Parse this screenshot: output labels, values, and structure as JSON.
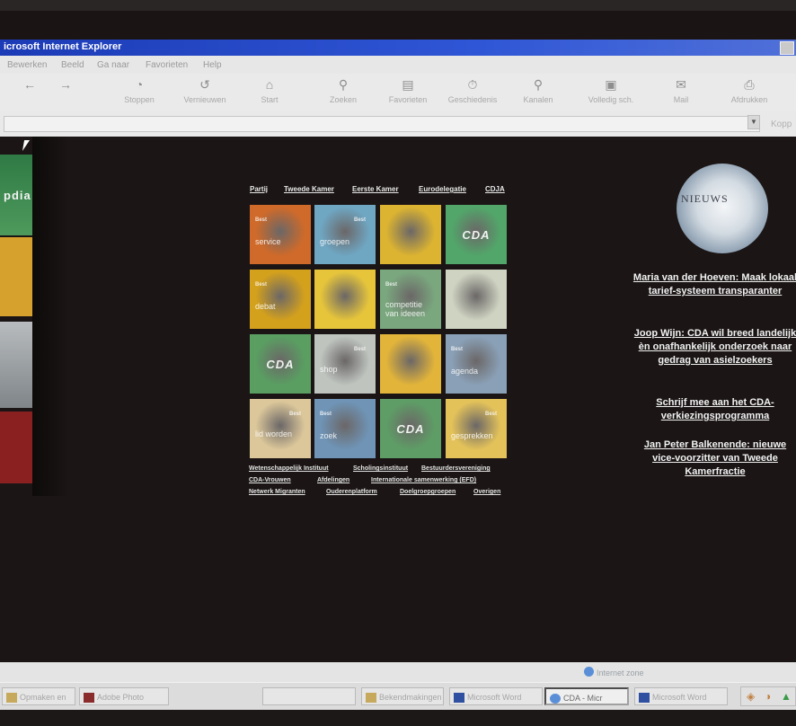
{
  "window": {
    "title": "icrosoft Internet Explorer"
  },
  "menu": [
    "Bewerken",
    "Beeld",
    "Ga naar",
    "Favorieten",
    "Help"
  ],
  "toolbar": [
    {
      "label": "",
      "icon": "back-arrow-icon"
    },
    {
      "label": "",
      "icon": "forward-arrow-icon"
    },
    {
      "label": "Stoppen",
      "icon": "stop-icon"
    },
    {
      "label": "Vernieuwen",
      "icon": "refresh-icon"
    },
    {
      "label": "Start",
      "icon": "home-icon"
    },
    {
      "label": "Zoeken",
      "icon": "search-icon"
    },
    {
      "label": "Favorieten",
      "icon": "favorites-icon"
    },
    {
      "label": "Geschiedenis",
      "icon": "history-icon"
    },
    {
      "label": "Kanalen",
      "icon": "channels-icon"
    },
    {
      "label": "Volledig sch.",
      "icon": "fullscreen-icon"
    },
    {
      "label": "Mail",
      "icon": "mail-icon"
    },
    {
      "label": "Afdrukken",
      "icon": "print-icon"
    }
  ],
  "address": {
    "links_label": "Kopp"
  },
  "left_frame": {
    "label": "pdia"
  },
  "top_nav": [
    "Partij",
    "Tweede Kamer",
    "Eerste Kamer",
    "Eurodelegatie",
    "CDJA"
  ],
  "tiles": [
    {
      "badge": "Best",
      "label": "service",
      "brand": ""
    },
    {
      "badge": "Best",
      "label": "groepen",
      "brand": ""
    },
    {
      "badge": "",
      "label": "",
      "brand": ""
    },
    {
      "badge": "",
      "label": "",
      "brand": "CDA"
    },
    {
      "badge": "Best",
      "label": "debat",
      "brand": ""
    },
    {
      "badge": "",
      "label": "",
      "brand": ""
    },
    {
      "badge": "Best",
      "label": "competitie van ideeen",
      "brand": ""
    },
    {
      "badge": "",
      "label": "",
      "brand": ""
    },
    {
      "badge": "",
      "label": "",
      "brand": "CDA"
    },
    {
      "badge": "Best",
      "label": "shop",
      "brand": ""
    },
    {
      "badge": "",
      "label": "",
      "brand": ""
    },
    {
      "badge": "Best",
      "label": "agenda",
      "brand": ""
    },
    {
      "badge": "Best",
      "label": "lid worden",
      "brand": ""
    },
    {
      "badge": "Best",
      "label": "zoek",
      "brand": ""
    },
    {
      "badge": "",
      "label": "",
      "brand": "CDA"
    },
    {
      "badge": "Best",
      "label": "gesprekken",
      "brand": ""
    }
  ],
  "tile_colors": [
    "#cf6a2a",
    "#6fa6c2",
    "#dcb431",
    "#52a66a",
    "#d4a11d",
    "#e6c53b",
    "#7aa77e",
    "#cfd4c2",
    "#5a9e62",
    "#bfc4bf",
    "#e2b43a",
    "#8aa0b6",
    "#dcc79a",
    "#6f94b6",
    "#5e9e66",
    "#e3c25a"
  ],
  "bottom_links": [
    [
      "Wetenschappelijk Instituut",
      "Scholingsinstituut",
      "Bestuurdersvereniging"
    ],
    [
      "CDA-Vrouwen",
      "Afdelingen",
      "Internationale samenwerking (EFD)"
    ],
    [
      "Netwerk Migranten",
      "Ouderenplatform",
      "Doelgroepgroepen",
      "Overigen"
    ]
  ],
  "news": {
    "logo_text": "NIEUWS",
    "headlines": [
      "Maria van der Hoeven: Maak lokaal tarief-systeem transparanter",
      "Joop Wijn: CDA wil breed landelijk èn onafhankelijk onderzoek naar gedrag van asielzoekers",
      "Schrijf mee aan het CDA-verkiezingsprogramma",
      "Jan Peter Balkenende: nieuwe vice-voorzitter van Tweede Kamerfractie"
    ]
  },
  "status": {
    "zone": "Internet zone"
  },
  "taskbar": [
    {
      "label": "Opmaken en",
      "icon": "folder-icon"
    },
    {
      "label": "Adobe Photo",
      "icon": "photoshop-icon"
    },
    {
      "label": "",
      "icon": ""
    },
    {
      "label": "Bekendmakingen",
      "icon": "folder-icon"
    },
    {
      "label": "Microsoft Word",
      "icon": "word-icon"
    },
    {
      "label": "CDA - Micr",
      "icon": "ie-icon"
    },
    {
      "label": "Microsoft Word",
      "icon": "word-icon"
    }
  ]
}
